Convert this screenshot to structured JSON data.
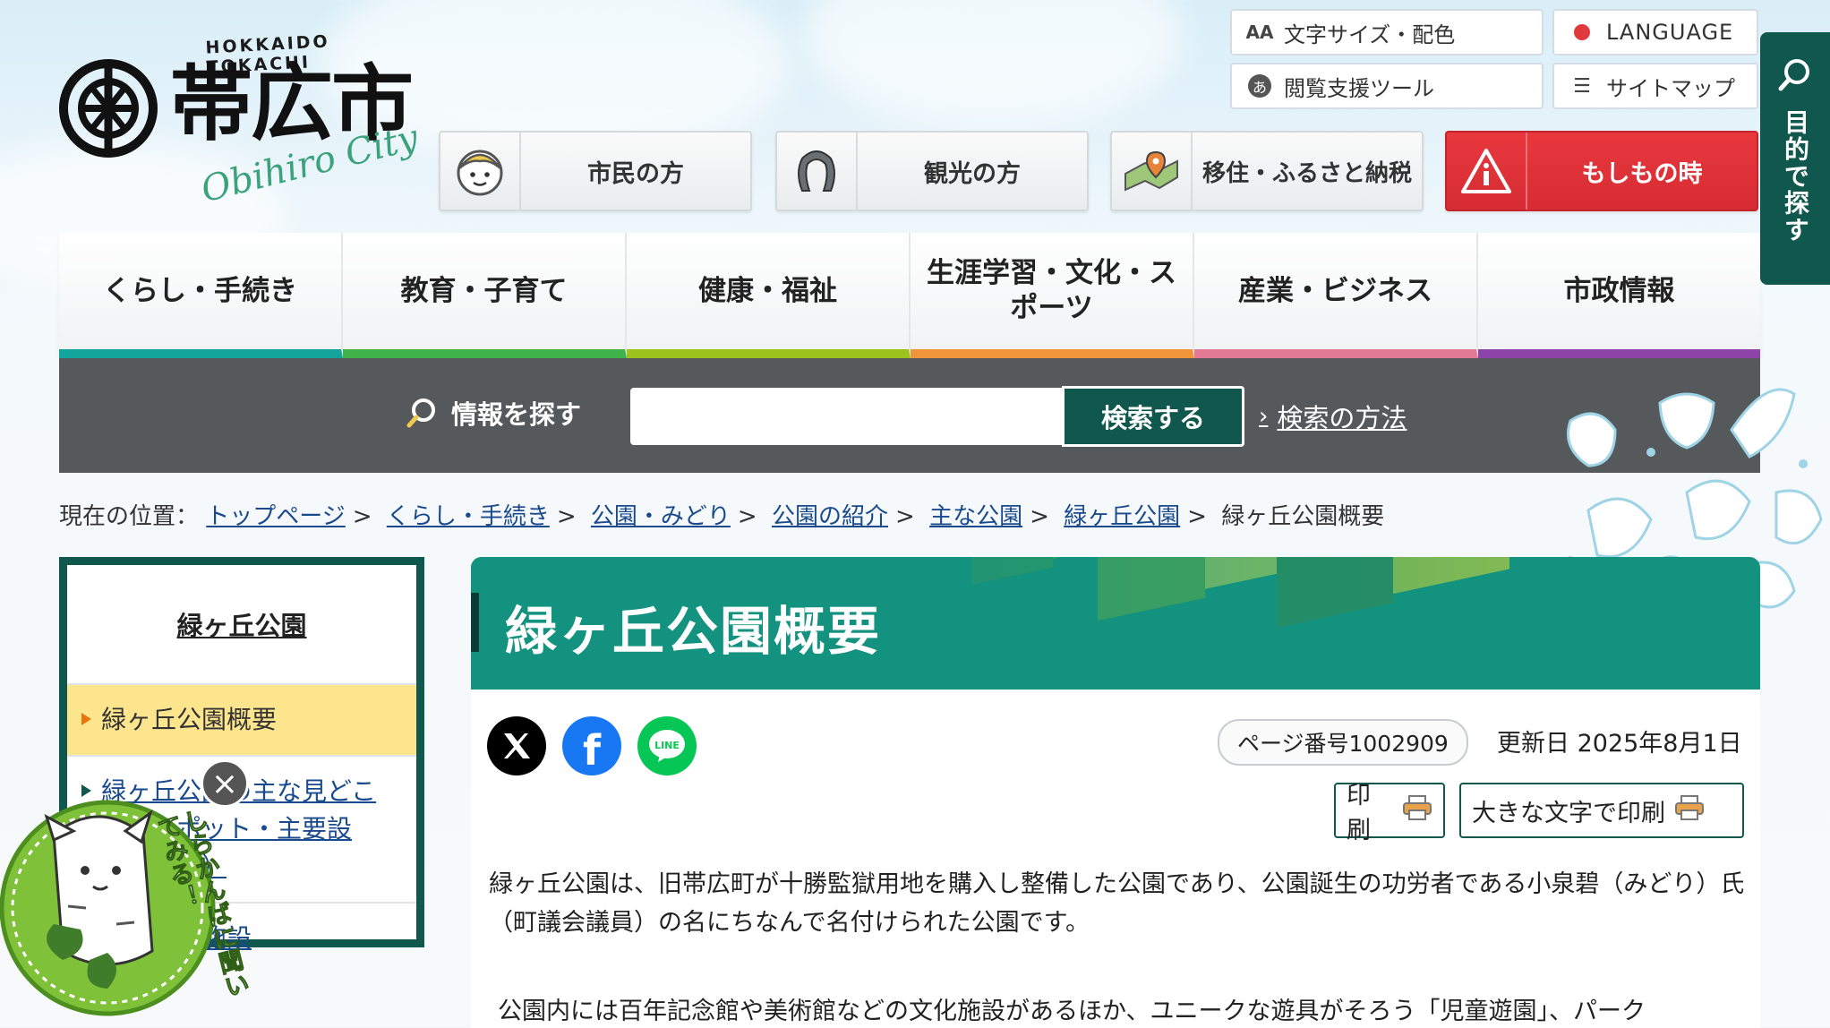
{
  "header": {
    "logo_top": "HOKKAIDO TOKACHI",
    "logo_city": "帯広市",
    "logo_script": "Obihiro City"
  },
  "utility": {
    "font_size": "文字サイズ・配色",
    "language": "LANGUAGE",
    "reading_support": "閲覧支援ツール",
    "sitemap": "サイトマップ"
  },
  "audience": [
    {
      "label": "市民の方",
      "icon": "citizen-face-icon"
    },
    {
      "label": "観光の方",
      "icon": "horseshoe-icon"
    },
    {
      "label": "移住・ふるさと納税",
      "icon": "map-pin-icon"
    },
    {
      "label": "もしもの時",
      "icon": "alert-info-icon"
    }
  ],
  "side_search": "目的で探す",
  "nav": [
    {
      "label": "くらし・手続き",
      "color": "#13a49b"
    },
    {
      "label": "教育・子育て",
      "color": "#3fb24a"
    },
    {
      "label": "健康・福祉",
      "color": "#9bc31c"
    },
    {
      "label": "生涯学習・文化・スポーツ",
      "color": "#f0953a"
    },
    {
      "label": "産業・ビジネス",
      "color": "#e27a96"
    },
    {
      "label": "市政情報",
      "color": "#8c44a8"
    }
  ],
  "search": {
    "title": "情報を探す",
    "button": "検索する",
    "how": "検索の方法",
    "placeholder": ""
  },
  "breadcrumb": {
    "prefix": "現在の位置：",
    "links": [
      "トップページ",
      "くらし・手続き",
      "公園・みどり",
      "公園の紹介",
      "主な公園",
      "緑ヶ丘公園"
    ],
    "current": "緑ヶ丘公園概要"
  },
  "leftnav": {
    "heading": "緑ヶ丘公園",
    "items": [
      "緑ヶ丘公園概要",
      "緑ヶ丘公園の主な見どころ（スポット・主要設備・遊具）",
      "公園内の施設"
    ]
  },
  "page": {
    "title": "緑ヶ丘公園概要",
    "page_number": "ページ番号1002909",
    "updated": "更新日 2025年8月1日",
    "print": "印刷",
    "print_large": "大きな文字で印刷",
    "para1": "緑ヶ丘公園は、旧帯広町が十勝監獄用地を購入し整備した公園であり、公園誕生の功労者である小泉碧（みどり）氏（町議会議員）の名にちなんで名付けられた公園です。",
    "para2": "公園内には百年記念館や美術館などの文化施設があるほか、ユニークな遊具がそろう「児童遊園」、パーク"
  },
  "mascot": {
    "text": "しらかんばに聞いてみる！"
  }
}
